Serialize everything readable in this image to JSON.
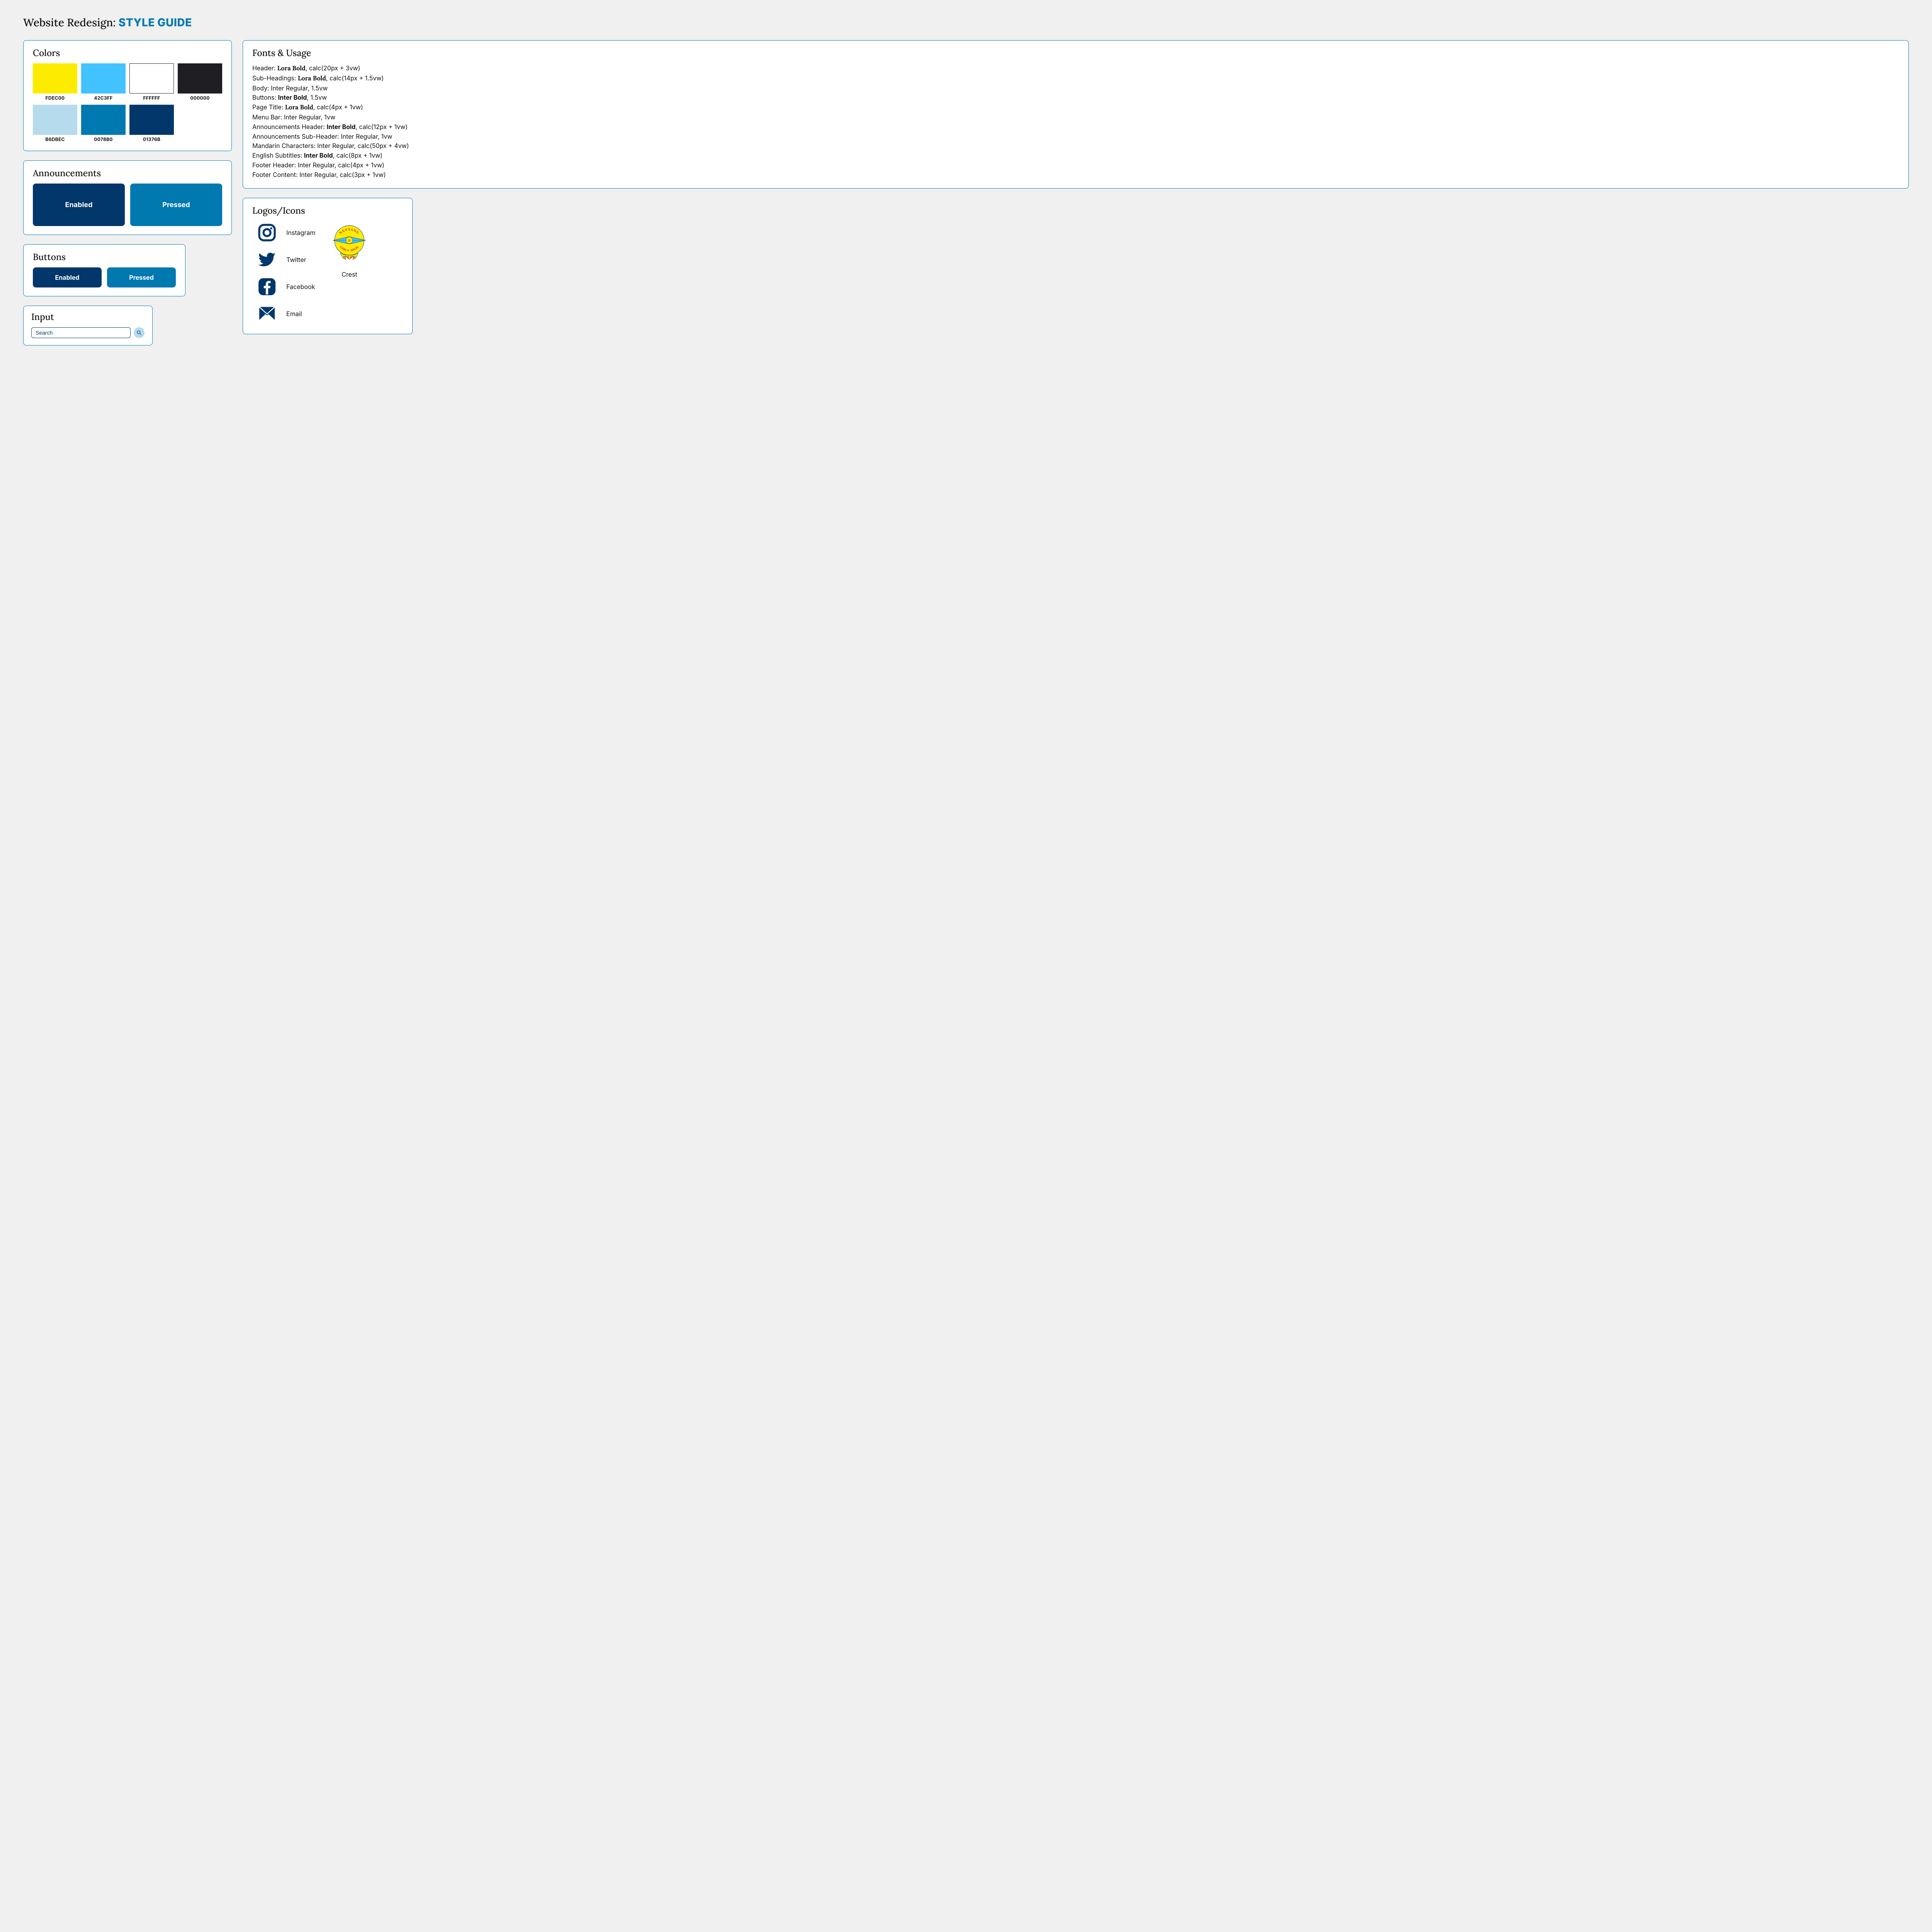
{
  "page": {
    "title_prefix": "Website Redesign: ",
    "title_suffix": "STYLE GUIDE"
  },
  "colors": {
    "heading": "Colors",
    "swatches": [
      {
        "hex": "FDEC00",
        "color": "#FDEC00",
        "bordered": false
      },
      {
        "hex": "42C3FF",
        "color": "#42C3FF",
        "bordered": false
      },
      {
        "hex": "FFFFFF",
        "color": "#FFFFFF",
        "bordered": true
      },
      {
        "hex": "000000",
        "color": "#1e1e23",
        "bordered": false
      },
      {
        "hex": "B6DBEC",
        "color": "#B6DBEC",
        "bordered": false
      },
      {
        "hex": "0078B0",
        "color": "#0078B0",
        "bordered": false
      },
      {
        "hex": "01376B",
        "color": "#01376B",
        "bordered": false
      }
    ]
  },
  "announcements": {
    "heading": "Announcements",
    "enabled_label": "Enabled",
    "pressed_label": "Pressed"
  },
  "buttons": {
    "heading": "Buttons",
    "enabled_label": "Enabled",
    "pressed_label": "Pressed"
  },
  "input": {
    "heading": "Input",
    "placeholder": "Search"
  },
  "fonts": {
    "heading": "Fonts & Usage",
    "items": [
      {
        "label": "Header: ",
        "font": "Lora Bold",
        "font_style": "serif",
        "size": ", calc(20px + 3vw)"
      },
      {
        "label": "Sub-Headings: ",
        "font": "Lora Bold",
        "font_style": "serif",
        "size": ", calc(14px + 1.5vw)"
      },
      {
        "label": "Body: ",
        "font": "Inter Regular",
        "font_style": "plain",
        "size": ", 1.5vw"
      },
      {
        "label": "Buttons: ",
        "font": "Inter Bold",
        "font_style": "sans",
        "size": ", 1.5vw"
      },
      {
        "label": "Page Title: ",
        "font": "Lora Bold",
        "font_style": "serif",
        "size": ", calc(4px + 1vw)"
      },
      {
        "label": "Menu Bar: ",
        "font": "Inter Regular",
        "font_style": "plain",
        "size": ",  1vw"
      },
      {
        "label": "Announcements Header: ",
        "font": "Inter Bold",
        "font_style": "sans",
        "size": ", calc(12px + 1vw)"
      },
      {
        "label": "Announcements Sub-Header: ",
        "font": "Inter Regular",
        "font_style": "plain",
        "size": ", 1vw"
      },
      {
        "label": "Mandarin Characters: ",
        "font": "Inter Regular",
        "font_style": "plain",
        "size": ", calc(50px + 4vw)"
      },
      {
        "label": "English Subtitles: ",
        "font": "Inter Bold",
        "font_style": "sans",
        "size": ", calc(8px + 1vw)"
      },
      {
        "label": "Footer Header: ",
        "font": "Inter Regular",
        "font_style": "plain",
        "size": ", calc(4px + 1vw)"
      },
      {
        "label": "Footer Content: ",
        "font": "Inter Regular",
        "font_style": "plain",
        "size": ", calc(3px + 1vw)"
      }
    ]
  },
  "logos": {
    "heading": "Logos/Icons",
    "items": [
      {
        "name": "Instagram"
      },
      {
        "name": "Twitter"
      },
      {
        "name": "Facebook"
      },
      {
        "name": "Email"
      }
    ],
    "crest_label": "Crest",
    "crest_top": "NANYANG",
    "crest_bottom": "GIRLS' HIGH"
  }
}
